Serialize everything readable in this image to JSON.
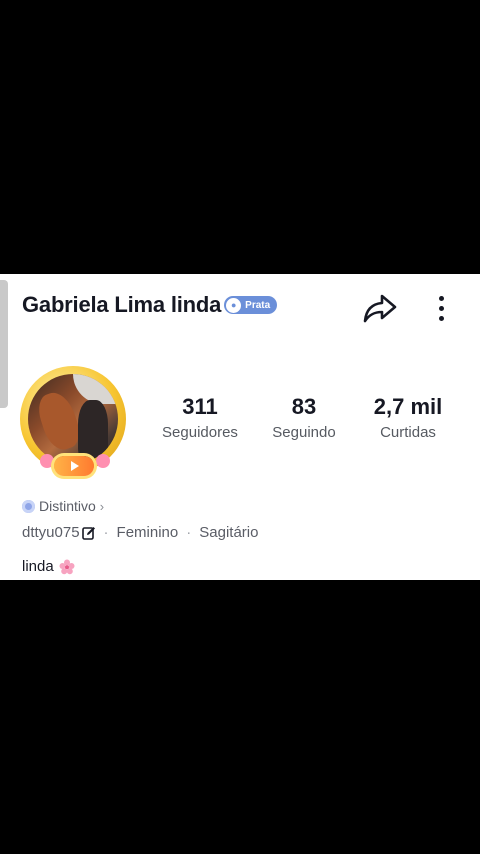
{
  "profile": {
    "username": "Gabriela Lima linda",
    "rank_label": "Prata",
    "stats": [
      {
        "value": "311",
        "label": "Seguidores"
      },
      {
        "value": "83",
        "label": "Seguindo"
      },
      {
        "value": "2,7 mil",
        "label": "Curtidas"
      }
    ],
    "badge_link": "Distintivo",
    "user_id": "dttyu075",
    "gender": "Feminino",
    "sign": "Sagitário",
    "bio": "linda"
  },
  "colors": {
    "background": "#000000",
    "card": "#ffffff",
    "rank_badge": "#6b8fd9",
    "text_primary": "#161823",
    "text_secondary": "#565a61",
    "avatar_ring": "#f7c531"
  },
  "icons": {
    "share": "share-arrow-icon",
    "more": "more-vertical-icon",
    "edit": "edit-icon",
    "badge": "badge-icon",
    "blossom": "cherry-blossom-icon",
    "live": "play-icon"
  }
}
